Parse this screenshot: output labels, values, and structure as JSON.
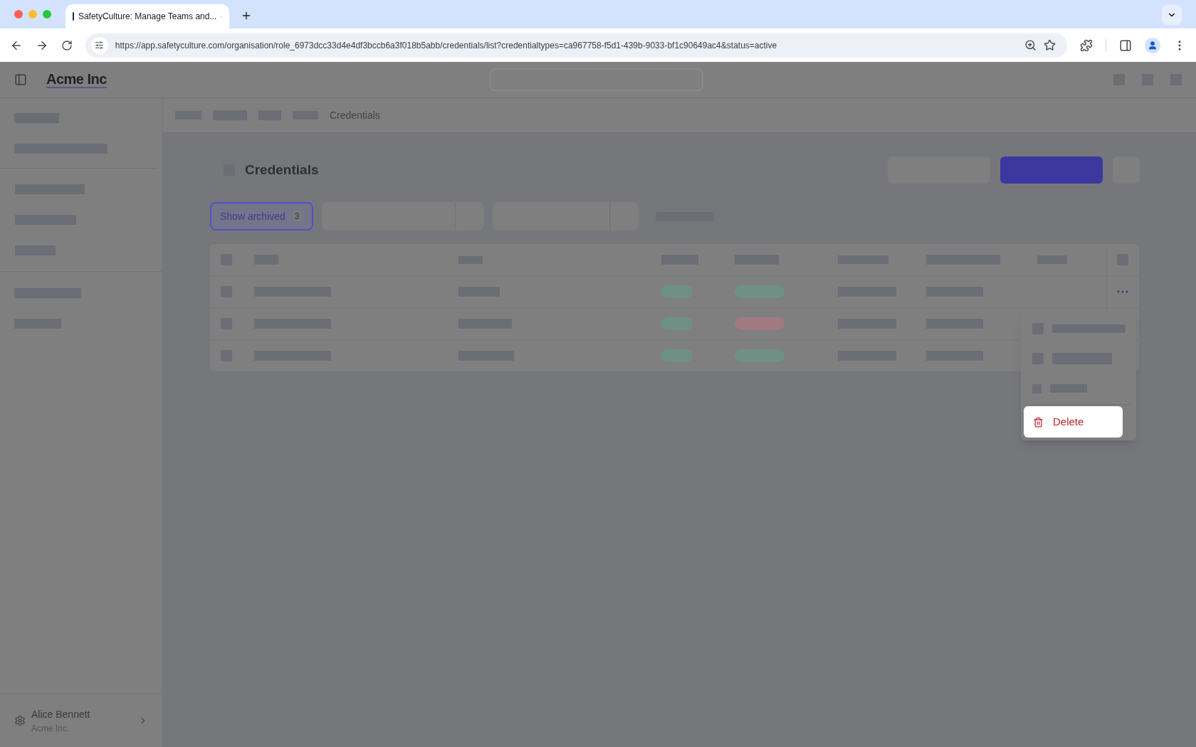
{
  "browser": {
    "tab_title": "SafetyCulture: Manage Teams and...",
    "url": "https://app.safetyculture.com/organisation/role_6973dcc33d4e4df3bccb6a3f018b5abb/credentials/list?credentialtypes=ca967758-f5d1-439b-9033-bf1c90649ac4&status=active"
  },
  "header": {
    "logo": "Acme Inc"
  },
  "breadcrumb": {
    "current": "Credentials"
  },
  "page": {
    "title": "Credentials"
  },
  "filters": {
    "show_archived": {
      "label": "Show archived",
      "count": "3"
    }
  },
  "table": {
    "rows": [
      {
        "color": "#6f9184"
      },
      {
        "color": "#a07a80"
      },
      {
        "color": "#6f9184"
      }
    ]
  },
  "menu": {
    "items": [
      {
        "label": "Delete"
      }
    ]
  },
  "user": {
    "name": "Alice Bennett",
    "org": "Acme Inc."
  }
}
